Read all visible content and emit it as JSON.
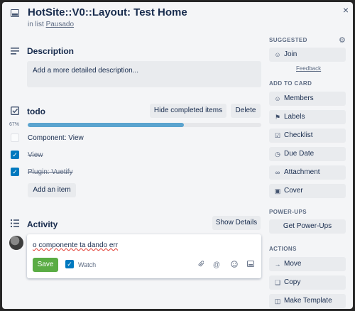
{
  "header": {
    "title": "HotSite::V0::Layout: Test Home",
    "list_prefix": "in list",
    "list_name": "Pausado",
    "close_label": "×"
  },
  "description": {
    "heading": "Description",
    "placeholder": "Add a more detailed description..."
  },
  "checklist": {
    "heading": "todo",
    "hide_completed_label": "Hide completed items",
    "delete_label": "Delete",
    "progress_text": "67%",
    "progress_value": 67,
    "items": [
      {
        "label": "Component: View",
        "checked": false
      },
      {
        "label": "View",
        "checked": true
      },
      {
        "label": "Plugin: Vuetify",
        "checked": true
      }
    ],
    "add_item_label": "Add an item"
  },
  "activity": {
    "heading": "Activity",
    "show_details_label": "Show Details",
    "comment_text": "o componente ta dando err",
    "save_label": "Save",
    "watch_label": "Watch",
    "watch_checked": true
  },
  "sidebar": {
    "suggested_heading": "SUGGESTED",
    "join_label": "Join",
    "feedback_label": "Feedback",
    "add_to_card_heading": "ADD TO CARD",
    "add_to_card": [
      {
        "label": "Members",
        "icon": "person-icon"
      },
      {
        "label": "Labels",
        "icon": "tag-icon"
      },
      {
        "label": "Checklist",
        "icon": "checklist-icon"
      },
      {
        "label": "Due Date",
        "icon": "clock-icon"
      },
      {
        "label": "Attachment",
        "icon": "paperclip-icon"
      },
      {
        "label": "Cover",
        "icon": "cover-icon"
      }
    ],
    "powerups_heading": "POWER-UPS",
    "get_powerups_label": "Get Power-Ups",
    "actions_heading": "ACTIONS",
    "actions": [
      {
        "label": "Move",
        "icon": "arrow-right-icon"
      },
      {
        "label": "Copy",
        "icon": "copy-icon"
      },
      {
        "label": "Make Template",
        "icon": "template-icon"
      }
    ]
  },
  "colors": {
    "progress": "#5ba4cf",
    "checkbox_checked": "#0079bf",
    "save_button": "#5aac44"
  }
}
